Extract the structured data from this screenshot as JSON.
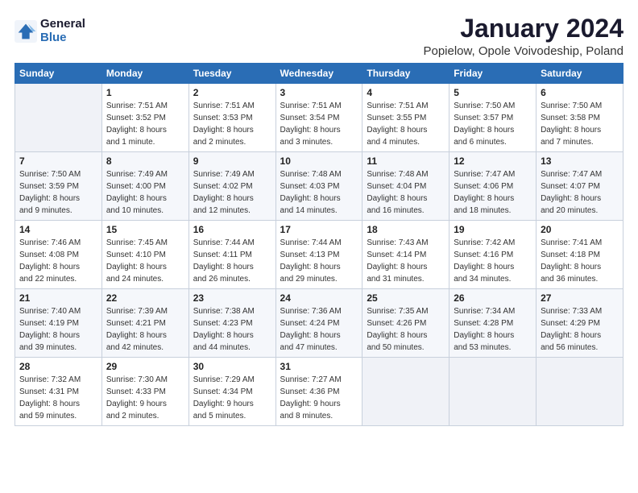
{
  "logo": {
    "general": "General",
    "blue": "Blue"
  },
  "title": "January 2024",
  "subtitle": "Popielow, Opole Voivodeship, Poland",
  "days_of_week": [
    "Sunday",
    "Monday",
    "Tuesday",
    "Wednesday",
    "Thursday",
    "Friday",
    "Saturday"
  ],
  "weeks": [
    [
      {
        "day": "",
        "info": ""
      },
      {
        "day": "1",
        "info": "Sunrise: 7:51 AM\nSunset: 3:52 PM\nDaylight: 8 hours\nand 1 minute."
      },
      {
        "day": "2",
        "info": "Sunrise: 7:51 AM\nSunset: 3:53 PM\nDaylight: 8 hours\nand 2 minutes."
      },
      {
        "day": "3",
        "info": "Sunrise: 7:51 AM\nSunset: 3:54 PM\nDaylight: 8 hours\nand 3 minutes."
      },
      {
        "day": "4",
        "info": "Sunrise: 7:51 AM\nSunset: 3:55 PM\nDaylight: 8 hours\nand 4 minutes."
      },
      {
        "day": "5",
        "info": "Sunrise: 7:50 AM\nSunset: 3:57 PM\nDaylight: 8 hours\nand 6 minutes."
      },
      {
        "day": "6",
        "info": "Sunrise: 7:50 AM\nSunset: 3:58 PM\nDaylight: 8 hours\nand 7 minutes."
      }
    ],
    [
      {
        "day": "7",
        "info": "Sunrise: 7:50 AM\nSunset: 3:59 PM\nDaylight: 8 hours\nand 9 minutes."
      },
      {
        "day": "8",
        "info": "Sunrise: 7:49 AM\nSunset: 4:00 PM\nDaylight: 8 hours\nand 10 minutes."
      },
      {
        "day": "9",
        "info": "Sunrise: 7:49 AM\nSunset: 4:02 PM\nDaylight: 8 hours\nand 12 minutes."
      },
      {
        "day": "10",
        "info": "Sunrise: 7:48 AM\nSunset: 4:03 PM\nDaylight: 8 hours\nand 14 minutes."
      },
      {
        "day": "11",
        "info": "Sunrise: 7:48 AM\nSunset: 4:04 PM\nDaylight: 8 hours\nand 16 minutes."
      },
      {
        "day": "12",
        "info": "Sunrise: 7:47 AM\nSunset: 4:06 PM\nDaylight: 8 hours\nand 18 minutes."
      },
      {
        "day": "13",
        "info": "Sunrise: 7:47 AM\nSunset: 4:07 PM\nDaylight: 8 hours\nand 20 minutes."
      }
    ],
    [
      {
        "day": "14",
        "info": "Sunrise: 7:46 AM\nSunset: 4:08 PM\nDaylight: 8 hours\nand 22 minutes."
      },
      {
        "day": "15",
        "info": "Sunrise: 7:45 AM\nSunset: 4:10 PM\nDaylight: 8 hours\nand 24 minutes."
      },
      {
        "day": "16",
        "info": "Sunrise: 7:44 AM\nSunset: 4:11 PM\nDaylight: 8 hours\nand 26 minutes."
      },
      {
        "day": "17",
        "info": "Sunrise: 7:44 AM\nSunset: 4:13 PM\nDaylight: 8 hours\nand 29 minutes."
      },
      {
        "day": "18",
        "info": "Sunrise: 7:43 AM\nSunset: 4:14 PM\nDaylight: 8 hours\nand 31 minutes."
      },
      {
        "day": "19",
        "info": "Sunrise: 7:42 AM\nSunset: 4:16 PM\nDaylight: 8 hours\nand 34 minutes."
      },
      {
        "day": "20",
        "info": "Sunrise: 7:41 AM\nSunset: 4:18 PM\nDaylight: 8 hours\nand 36 minutes."
      }
    ],
    [
      {
        "day": "21",
        "info": "Sunrise: 7:40 AM\nSunset: 4:19 PM\nDaylight: 8 hours\nand 39 minutes."
      },
      {
        "day": "22",
        "info": "Sunrise: 7:39 AM\nSunset: 4:21 PM\nDaylight: 8 hours\nand 42 minutes."
      },
      {
        "day": "23",
        "info": "Sunrise: 7:38 AM\nSunset: 4:23 PM\nDaylight: 8 hours\nand 44 minutes."
      },
      {
        "day": "24",
        "info": "Sunrise: 7:36 AM\nSunset: 4:24 PM\nDaylight: 8 hours\nand 47 minutes."
      },
      {
        "day": "25",
        "info": "Sunrise: 7:35 AM\nSunset: 4:26 PM\nDaylight: 8 hours\nand 50 minutes."
      },
      {
        "day": "26",
        "info": "Sunrise: 7:34 AM\nSunset: 4:28 PM\nDaylight: 8 hours\nand 53 minutes."
      },
      {
        "day": "27",
        "info": "Sunrise: 7:33 AM\nSunset: 4:29 PM\nDaylight: 8 hours\nand 56 minutes."
      }
    ],
    [
      {
        "day": "28",
        "info": "Sunrise: 7:32 AM\nSunset: 4:31 PM\nDaylight: 8 hours\nand 59 minutes."
      },
      {
        "day": "29",
        "info": "Sunrise: 7:30 AM\nSunset: 4:33 PM\nDaylight: 9 hours\nand 2 minutes."
      },
      {
        "day": "30",
        "info": "Sunrise: 7:29 AM\nSunset: 4:34 PM\nDaylight: 9 hours\nand 5 minutes."
      },
      {
        "day": "31",
        "info": "Sunrise: 7:27 AM\nSunset: 4:36 PM\nDaylight: 9 hours\nand 8 minutes."
      },
      {
        "day": "",
        "info": ""
      },
      {
        "day": "",
        "info": ""
      },
      {
        "day": "",
        "info": ""
      }
    ]
  ]
}
